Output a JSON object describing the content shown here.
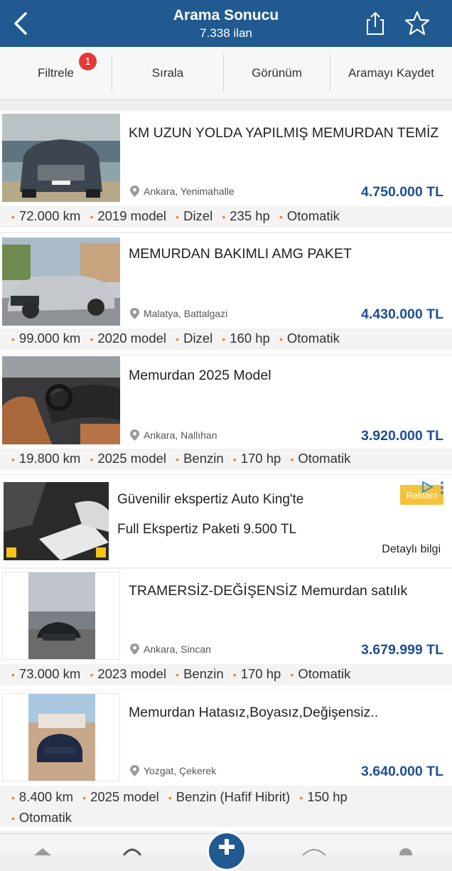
{
  "header": {
    "title": "Arama Sonucu",
    "count": "7.338 ilan"
  },
  "toolbar": {
    "filter": "Filtrele",
    "filter_badge": "1",
    "sort": "Sırala",
    "view": "Görünüm",
    "save": "Aramayı Kaydet"
  },
  "listings": [
    {
      "title": "KM UZUN YOLDA YAPILMIŞ MEMURDAN TEMİZ",
      "location": "Ankara, Yenimahalle",
      "price": "4.750.000 TL",
      "specs": [
        "72.000 km",
        "2019 model",
        "Dizel",
        "235 hp",
        "Otomatik"
      ]
    },
    {
      "title": "MEMURDAN BAKIMLI AMG PAKET",
      "location": "Malatya, Battalgazi",
      "price": "4.430.000 TL",
      "specs": [
        "99.000 km",
        "2020 model",
        "Dizel",
        "160 hp",
        "Otomatik"
      ]
    },
    {
      "title": "Memurdan 2025 Model",
      "location": "Ankara, Nallıhan",
      "price": "3.920.000 TL",
      "specs": [
        "19.800 km",
        "2025 model",
        "Benzin",
        "170 hp",
        "Otomatik"
      ]
    },
    {
      "title": "TRAMERSİZ-DEĞİŞENSİZ Memurdan satılık",
      "location": "Ankara, Sincan",
      "price": "3.679.999 TL",
      "specs": [
        "73.000 km",
        "2023 model",
        "Benzin",
        "170 hp",
        "Otomatik"
      ]
    },
    {
      "title": "Memurdan Hatasız,Boyasız,Değişensiz..",
      "location": "Yozgat, Çekerek",
      "price": "3.640.000 TL",
      "specs": [
        "8.400 km",
        "2025 model",
        "Benzin (Hafif Hibrit)",
        "150 hp",
        "Otomatik"
      ]
    }
  ],
  "ad": {
    "line1": "Güvenilir ekspertiz Auto King'te",
    "line2": "Full Ekspertiz Paketi 9.500 TL",
    "more": "Detaylı bilgi",
    "tag": "Reklam"
  },
  "colors": {
    "header": "#215a91",
    "price": "#1d4f94",
    "bullet": "#e8832f",
    "badge": "#e53935"
  }
}
